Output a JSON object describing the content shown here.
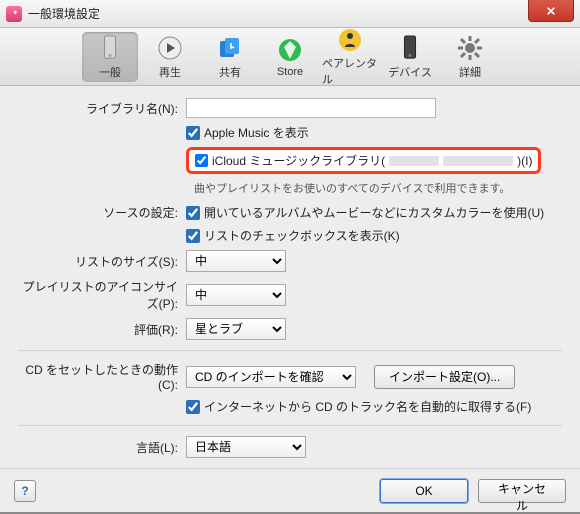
{
  "window": {
    "title": "一般環境設定"
  },
  "toolbar": {
    "items": [
      {
        "id": "general",
        "label": "一般"
      },
      {
        "id": "playback",
        "label": "再生"
      },
      {
        "id": "sharing",
        "label": "共有"
      },
      {
        "id": "store",
        "label": "Store"
      },
      {
        "id": "parental",
        "label": "ペアレンタル"
      },
      {
        "id": "devices",
        "label": "デバイス"
      },
      {
        "id": "advanced",
        "label": "詳細"
      }
    ],
    "selected": "general"
  },
  "general": {
    "library_name_label": "ライブラリ名(N):",
    "library_name_value": "",
    "show_apple_music": {
      "label": "Apple Music を表示",
      "checked": true
    },
    "icloud_music_library": {
      "label_prefix": "iCloud ミュージックライブラリ(",
      "label_suffix": ")(I)",
      "checked": true
    },
    "note": "曲やプレイリストをお使いのすべてのデバイスで利用できます。",
    "source_settings_label": "ソースの設定:",
    "custom_color": {
      "label": "開いているアルバムやムービーなどにカスタムカラーを使用(U)",
      "checked": true
    },
    "list_checkbox": {
      "label": "リストのチェックボックスを表示(K)",
      "checked": true
    },
    "list_size_label": "リストのサイズ(S):",
    "list_size_value": "中",
    "playlist_icon_label": "プレイリストのアイコンサイズ(P):",
    "playlist_icon_value": "中",
    "rating_label": "評価(R):",
    "rating_value": "星とラブ",
    "cd_insert_label": "CD をセットしたときの動作(C):",
    "cd_insert_value": "CD のインポートを確認",
    "import_settings_btn": "インポート設定(O)...",
    "auto_tracknames": {
      "label": "インターネットから CD のトラック名を自動的に取得する(F)",
      "checked": true
    },
    "language_label": "言語(L):",
    "language_value": "日本語"
  },
  "footer": {
    "help": "?",
    "ok": "OK",
    "cancel": "キャンセル"
  }
}
